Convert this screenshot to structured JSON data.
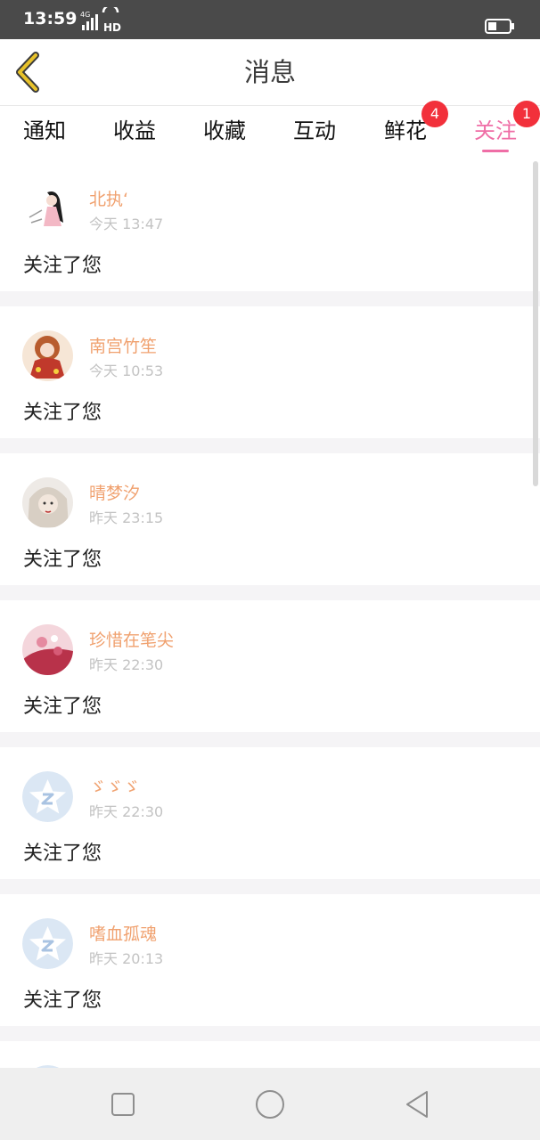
{
  "status_bar": {
    "time": "13:59",
    "network": "4G",
    "hd": "HD"
  },
  "header": {
    "title": "消息",
    "back_icon": "chevron-left-icon"
  },
  "tabs": [
    {
      "label": "通知",
      "badge": ""
    },
    {
      "label": "收益",
      "badge": ""
    },
    {
      "label": "收藏",
      "badge": ""
    },
    {
      "label": "互动",
      "badge": ""
    },
    {
      "label": "鲜花",
      "badge": "4"
    },
    {
      "label": "关注",
      "badge": "1",
      "active": true
    }
  ],
  "items": [
    {
      "name": "北执‘",
      "time": "今天 13:47",
      "text": "关注了您"
    },
    {
      "name": "南宫竹笙",
      "time": "今天 10:53",
      "text": "关注了您"
    },
    {
      "name": "晴梦汐",
      "time": "昨天 23:15",
      "text": "关注了您"
    },
    {
      "name": "珍惜在笔尖",
      "time": "昨天 22:30",
      "text": "关注了您"
    },
    {
      "name": "ゞゞゞ",
      "time": "昨天 22:30",
      "text": "关注了您"
    },
    {
      "name": "嗜血孤魂",
      "time": "昨天 20:13",
      "text": "关注了您"
    }
  ],
  "colors": {
    "accent": "#ef6ea6",
    "username": "#f0a16f",
    "badge": "#f2303b",
    "back": "#e8c22a"
  },
  "navbar": {
    "icons": [
      "square-recent-icon",
      "circle-home-icon",
      "triangle-back-icon"
    ]
  }
}
